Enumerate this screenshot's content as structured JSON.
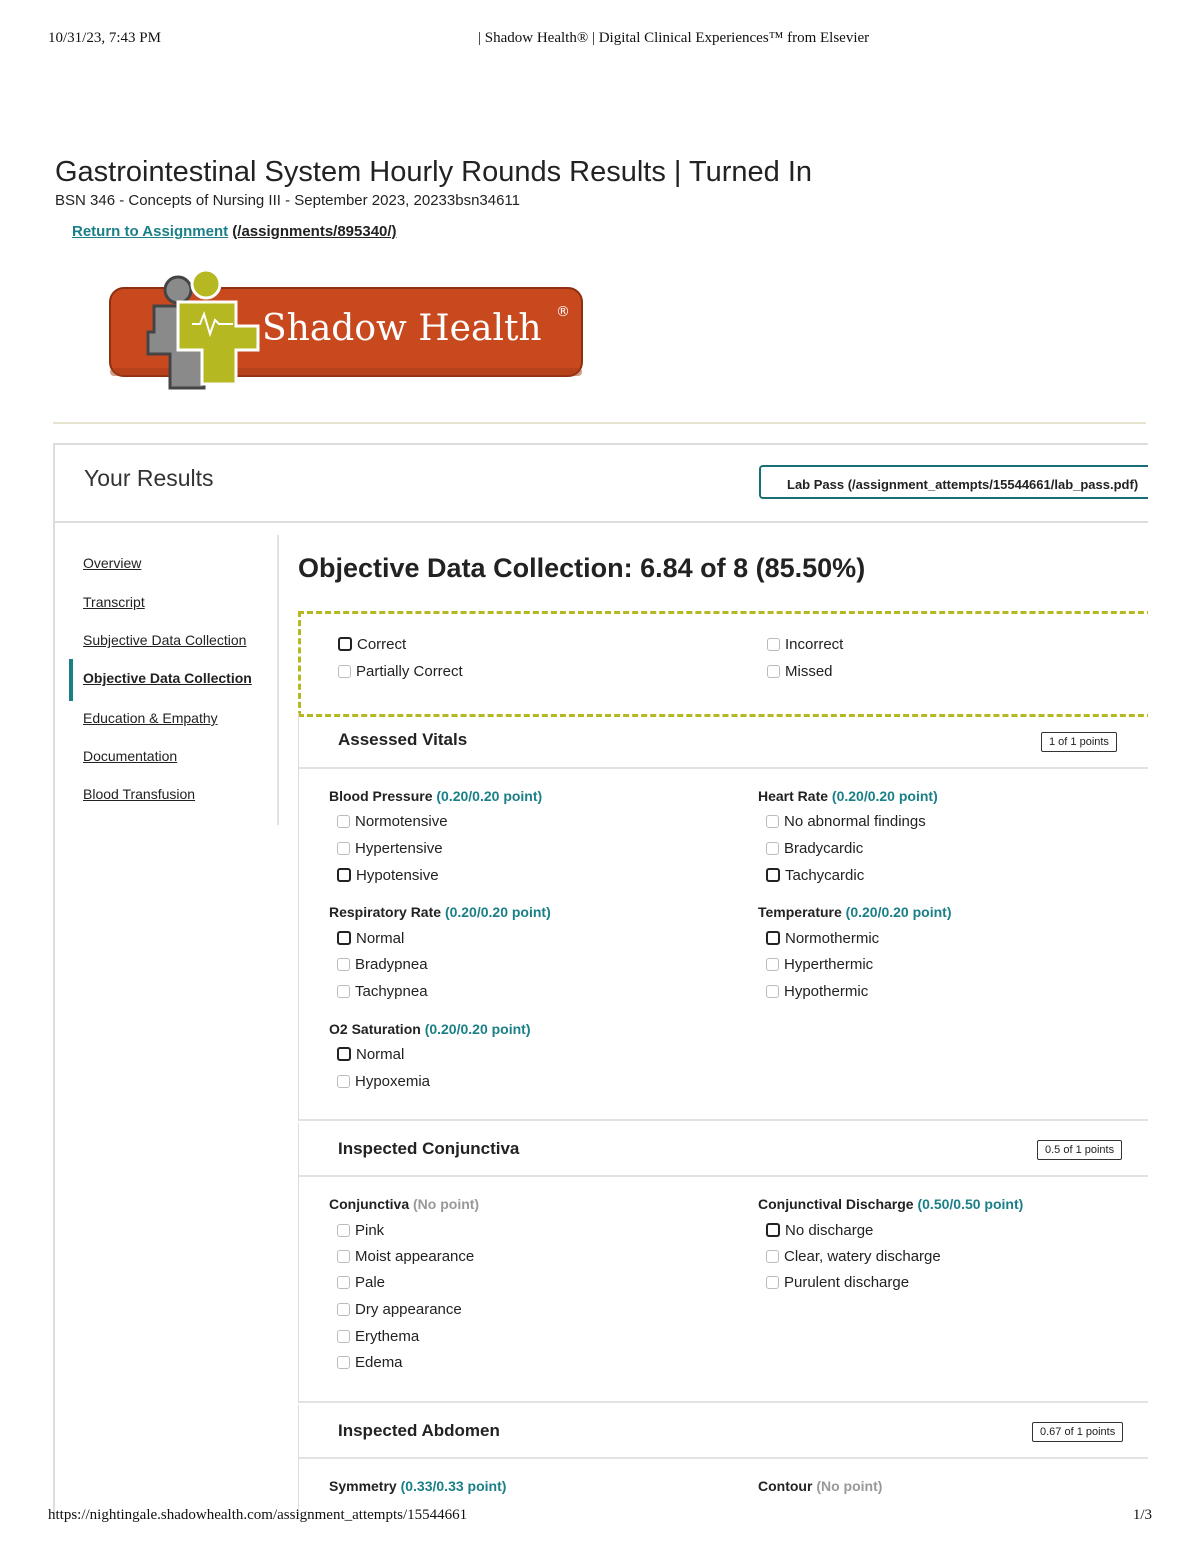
{
  "pdf": {
    "datetime": "10/31/23, 7:43 PM",
    "doc_title": "| Shadow Health® | Digital Clinical Experiences™ from Elsevier",
    "url": "https://nightingale.shadowhealth.com/assignment_attempts/15544661",
    "page": "1/3"
  },
  "header": {
    "title": "Gastrointestinal System Hourly Rounds Results | Turned In",
    "course": "BSN 346 - Concepts of Nursing III - September 2023, 20233bsn34611",
    "return_link": "Return to Assignment",
    "return_path": "(/assignments/895340/)"
  },
  "logo": {
    "text": "Shadow Health",
    "registered": "®",
    "brand_color": "#c9491f",
    "figure_color": "#b5b821"
  },
  "results": {
    "heading": "Your Results",
    "lab_pass": "Lab Pass (/assignment_attempts/15544661/lab_pass.pdf)"
  },
  "nav": {
    "items": [
      {
        "label": "Overview"
      },
      {
        "label": "Transcript"
      },
      {
        "label": "Subjective Data Collection"
      },
      {
        "label": "Objective Data Collection",
        "active": true
      },
      {
        "label": "Education & Empathy"
      },
      {
        "label": "Documentation"
      },
      {
        "label": "Blood Transfusion"
      }
    ]
  },
  "section": {
    "title": "Objective Data Collection: 6.84 of 8 (85.50%)",
    "legend": {
      "correct": "Correct",
      "partially_correct": "Partially Correct",
      "incorrect": "Incorrect",
      "missed": "Missed"
    }
  },
  "panels": {
    "vitals": {
      "title": "Assessed Vitals",
      "points": "1 of 1 points",
      "bp": {
        "label": "Blood Pressure",
        "pts": "(0.20/0.20 point)",
        "options": [
          "Normotensive",
          "Hypertensive",
          "Hypotensive"
        ]
      },
      "hr": {
        "label": "Heart Rate",
        "pts": "(0.20/0.20 point)",
        "options": [
          "No abnormal findings",
          "Bradycardic",
          "Tachycardic"
        ]
      },
      "rr": {
        "label": "Respiratory Rate",
        "pts": "(0.20/0.20 point)",
        "options": [
          "Normal",
          "Bradypnea",
          "Tachypnea"
        ]
      },
      "temp": {
        "label": "Temperature",
        "pts": "(0.20/0.20 point)",
        "options": [
          "Normothermic",
          "Hyperthermic",
          "Hypothermic"
        ]
      },
      "o2": {
        "label": "O2 Saturation",
        "pts": "(0.20/0.20 point)",
        "options": [
          "Normal",
          "Hypoxemia"
        ]
      }
    },
    "conjunctiva": {
      "title": "Inspected Conjunctiva",
      "points": "0.5 of 1 points",
      "conj": {
        "label": "Conjunctiva",
        "pts": "(No point)",
        "options": [
          "Pink",
          "Moist appearance",
          "Pale",
          "Dry appearance",
          "Erythema",
          "Edema"
        ]
      },
      "discharge": {
        "label": "Conjunctival Discharge",
        "pts": "(0.50/0.50 point)",
        "options": [
          "No discharge",
          "Clear, watery discharge",
          "Purulent discharge"
        ]
      }
    },
    "abdomen": {
      "title": "Inspected Abdomen",
      "points": "0.67 of 1 points",
      "symmetry": {
        "label": "Symmetry",
        "pts": "(0.33/0.33 point)"
      },
      "contour": {
        "label": "Contour",
        "pts": "(No point)"
      }
    }
  }
}
